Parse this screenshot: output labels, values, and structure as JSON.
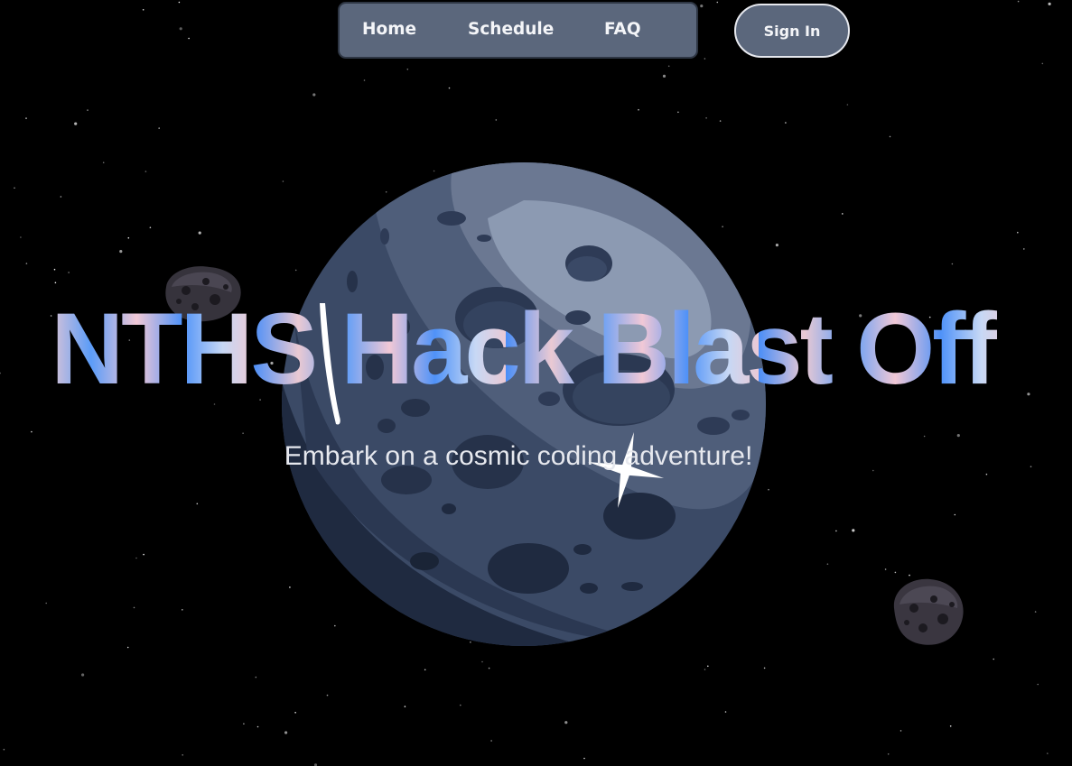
{
  "nav": {
    "links": [
      {
        "label": "Home"
      },
      {
        "label": "Schedule"
      },
      {
        "label": "FAQ"
      }
    ],
    "sign_in_label": "Sign In"
  },
  "hero": {
    "title": "NTHS Hack Blast Off",
    "subtitle": "Embark on a cosmic coding adventure!"
  },
  "decor": {
    "background_icon": "starfield",
    "planet_icon": "cratered-moon",
    "asteroid_icon": "asteroid-rock",
    "sparkle_icon": "four-point-sparkle",
    "streak_icon": "light-streak"
  },
  "colors": {
    "background": "#000000",
    "nav_background": "#5b677c",
    "nav_text": "#f4f5f8",
    "title_gradient_blue": "#4a8ef8",
    "title_gradient_pink": "#eac9d3",
    "subtitle": "#e6e8ee",
    "planet_base": "#3a4a66",
    "planet_highlight": "#8c9ab2"
  }
}
